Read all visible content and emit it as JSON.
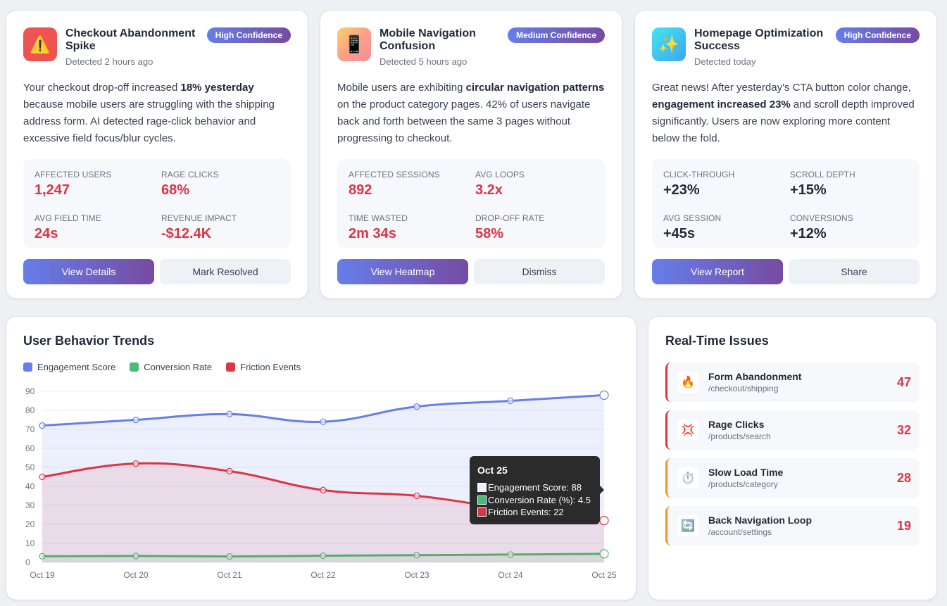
{
  "insights": [
    {
      "icon": "⚠️",
      "icon_name": "warning-icon",
      "icon_bg": "#ef5350",
      "title": "Checkout Abandonment Spike",
      "time": "Detected 2 hours ago",
      "badge": "High Confidence",
      "desc_parts": [
        "Your checkout drop-off increased ",
        "18% yesterday",
        " because mobile users are struggling with the shipping address form. AI detected rage-click behavior and excessive field focus/blur cycles."
      ],
      "metrics": [
        {
          "label": "AFFECTED USERS",
          "value": "1,247"
        },
        {
          "label": "RAGE CLICKS",
          "value": "68%"
        },
        {
          "label": "AVG FIELD TIME",
          "value": "24s"
        },
        {
          "label": "REVENUE IMPACT",
          "value": "-$12.4K"
        }
      ],
      "primary": "View Details",
      "secondary": "Mark Resolved"
    },
    {
      "icon": "📱",
      "icon_name": "mobile-phone-icon",
      "icon_bg": "#f8a56b",
      "title": "Mobile Navigation Confusion",
      "time": "Detected 5 hours ago",
      "badge": "Medium Confidence",
      "desc_parts": [
        "Mobile users are exhibiting ",
        "circular navigation patterns",
        " on the product category pages. 42% of users navigate back and forth between the same 3 pages without progressing to checkout."
      ],
      "metrics": [
        {
          "label": "AFFECTED SESSIONS",
          "value": "892"
        },
        {
          "label": "AVG LOOPS",
          "value": "3.2x"
        },
        {
          "label": "TIME WASTED",
          "value": "2m 34s"
        },
        {
          "label": "DROP-OFF RATE",
          "value": "58%"
        }
      ],
      "primary": "View Heatmap",
      "secondary": "Dismiss"
    },
    {
      "icon": "✨",
      "icon_name": "sparkles-icon",
      "icon_bg": "#4fc3f7",
      "title": "Homepage Optimization Success",
      "time": "Detected today",
      "badge": "High Confidence",
      "desc_parts": [
        "Great news! After yesterday's CTA button color change, ",
        "engagement increased 23%",
        " and scroll depth improved significantly. Users are now exploring more content below the fold."
      ],
      "metrics": [
        {
          "label": "CLICK-THROUGH",
          "value": "+23%"
        },
        {
          "label": "SCROLL DEPTH",
          "value": "+15%"
        },
        {
          "label": "AVG SESSION",
          "value": "+45s"
        },
        {
          "label": "CONVERSIONS",
          "value": "+12%"
        }
      ],
      "primary": "View Report",
      "secondary": "Share"
    }
  ],
  "chart_title": "User Behavior Trends",
  "chart_data": {
    "type": "line",
    "categories": [
      "Oct 19",
      "Oct 20",
      "Oct 21",
      "Oct 22",
      "Oct 23",
      "Oct 24",
      "Oct 25"
    ],
    "series": [
      {
        "name": "Engagement Score",
        "values": [
          72,
          75,
          78,
          74,
          82,
          85,
          88
        ],
        "color": "#667eea"
      },
      {
        "name": "Conversion Rate",
        "values": [
          3.2,
          3.4,
          3.1,
          3.5,
          3.8,
          4.1,
          4.5
        ],
        "color": "#48bb78"
      },
      {
        "name": "Friction Events",
        "values": [
          45,
          52,
          48,
          38,
          35,
          28,
          22
        ],
        "color": "#dc3545"
      }
    ],
    "y_ticks": [
      "0",
      "10",
      "20",
      "30",
      "40",
      "50",
      "60",
      "70",
      "80",
      "90"
    ],
    "ylim": [
      0,
      90
    ],
    "legend": "top-left",
    "grid": true
  },
  "tooltip": {
    "title": "Oct 25",
    "rows": [
      "Engagement Score: 88",
      "Conversion Rate (%): 4.5",
      "Friction Events: 22"
    ]
  },
  "issues_title": "Real-Time Issues",
  "issues": [
    {
      "icon": "🔥",
      "icon_name": "fire-icon",
      "name": "Form Abandonment",
      "path": "/checkout/shipping",
      "count": "47",
      "level": "critical"
    },
    {
      "icon": "💢",
      "icon_name": "anger-icon",
      "name": "Rage Clicks",
      "path": "/products/search",
      "count": "32",
      "level": "critical"
    },
    {
      "icon": "⏱️",
      "icon_name": "stopwatch-icon",
      "name": "Slow Load Time",
      "path": "/products/category",
      "count": "28",
      "level": "warning"
    },
    {
      "icon": "🔄",
      "icon_name": "loop-arrows-icon",
      "name": "Back Navigation Loop",
      "path": "/account/settings",
      "count": "19",
      "level": "warning"
    }
  ]
}
